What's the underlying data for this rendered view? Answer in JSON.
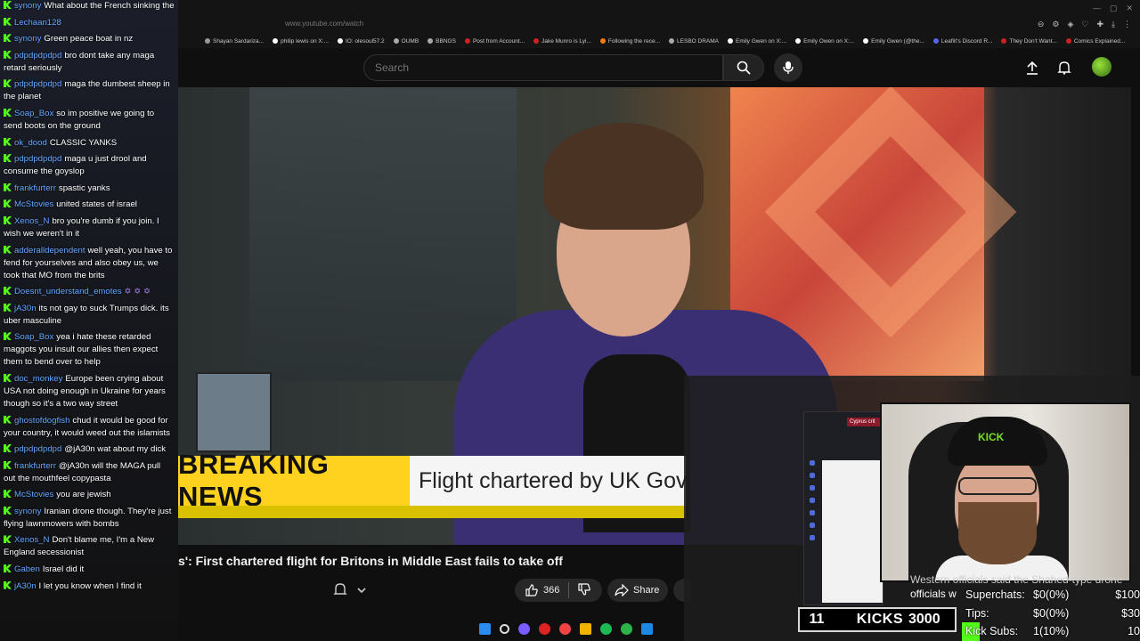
{
  "browser": {
    "url": "www.youtube.com/watch",
    "bookmarks": [
      {
        "label": "Shayan Sardariza...",
        "color": "#999999"
      },
      {
        "label": "philip lewis on X:...",
        "color": "#ffffff"
      },
      {
        "label": "IO: olesoul57.2",
        "color": "#ffffff"
      },
      {
        "label": "OUMB",
        "color": "#aaaaaa"
      },
      {
        "label": "BBNGS",
        "color": "#aaaaaa"
      },
      {
        "label": "Post from Account...",
        "color": "#cc2222"
      },
      {
        "label": "Jake Munro is Lyi...",
        "color": "#cc2222"
      },
      {
        "label": "Following the rece...",
        "color": "#ff7a00"
      },
      {
        "label": "LESBO DRAMA",
        "color": "#aaaaaa"
      },
      {
        "label": "Emily Gwen on X:...",
        "color": "#ffffff"
      },
      {
        "label": "Emily Owen on X:...",
        "color": "#ffffff"
      },
      {
        "label": "Emily Gwen (@the...",
        "color": "#ffffff"
      },
      {
        "label": "Leaflit's Discord R...",
        "color": "#5865f2"
      },
      {
        "label": "They Don't Want...",
        "color": "#cc2222"
      },
      {
        "label": "Comics Explained...",
        "color": "#cc2222"
      }
    ]
  },
  "header": {
    "search_placeholder": "Search"
  },
  "video": {
    "breaking_tag": "BREAKING NEWS",
    "breaking_text": "Flight chartered by UK Gov",
    "title": "s': First chartered flight for Britons in Middle East fails to take off",
    "likes": "366",
    "share_label": "Share"
  },
  "overlay": {
    "mini_tab": "Cyprus crit",
    "cap_text": "KICK",
    "ghost_line1": "Western officials said the Shahed-type drone",
    "ghost_line2": "officials w",
    "stats": [
      {
        "label": "Superchats:",
        "value": "$0(0%)",
        "goal": "$100"
      },
      {
        "label": "Tips:",
        "value": "$0(0%)",
        "goal": "$30"
      },
      {
        "label": "Kick Subs:",
        "value": "1(10%)",
        "goal": "10"
      }
    ],
    "kicks_count": "11",
    "kicks_label": "KICKS",
    "kicks_target": "3000"
  },
  "chat": [
    {
      "user": "synony",
      "text": "What about the French sinking the"
    },
    {
      "user": "Lechaan128",
      "text": ""
    },
    {
      "user": "synony",
      "text": "Green peace boat in nz"
    },
    {
      "user": "pdpdpdpdpd",
      "text": "bro dont take any maga retard seriously"
    },
    {
      "user": "pdpdpdpdpd",
      "text": "maga the dumbest sheep in the planet"
    },
    {
      "user": "Soap_Box",
      "text": "so im positive we going to send boots on the ground"
    },
    {
      "user": "ok_dood",
      "text": "CLASSIC YANKS"
    },
    {
      "user": "pdpdpdpdpd",
      "text": "maga u just drool and consume the goyslop"
    },
    {
      "user": "frankfurterr",
      "text": "spastic yanks"
    },
    {
      "user": "McStovies",
      "text": "united states of israel"
    },
    {
      "user": "Xenos_N",
      "text": "bro you're dumb if you join. I wish we weren't in it"
    },
    {
      "user": "adderalldependent",
      "text": "well yeah, you have to fend for yourselves and also obey us, we took that MO from the brits"
    },
    {
      "user": "Doesnt_understand_emotes",
      "text": "✡ ✡ ✡"
    },
    {
      "user": "jA30n",
      "text": "its not gay to suck Trumps dick. its uber masculine"
    },
    {
      "user": "Soap_Box",
      "text": "yea i hate these retarded maggots you insult our allies then expect them to bend over to help"
    },
    {
      "user": "doc_monkey",
      "text": "Europe been crying about USA not doing enough in Ukraine for years though so it's a two way street"
    },
    {
      "user": "ghostofdogfish",
      "text": "chud it would be good for your country, it would weed out the islamists"
    },
    {
      "user": "pdpdpdpdpd",
      "text": "@jA30n wat about my dick"
    },
    {
      "user": "frankfurterr",
      "text": "@jA30n will the MAGA pull out the mouthfeel copypasta"
    },
    {
      "user": "McStovies",
      "text": "you are jewish"
    },
    {
      "user": "synony",
      "text": "Iranian drone though. They're just flying lawnmowers with bombs"
    },
    {
      "user": "Xenos_N",
      "text": "Don't blame me, I'm a New England secessionist"
    },
    {
      "user": "Gaben",
      "text": "Israel did it"
    },
    {
      "user": "jA30n",
      "text": "I let you know when I find it"
    }
  ]
}
